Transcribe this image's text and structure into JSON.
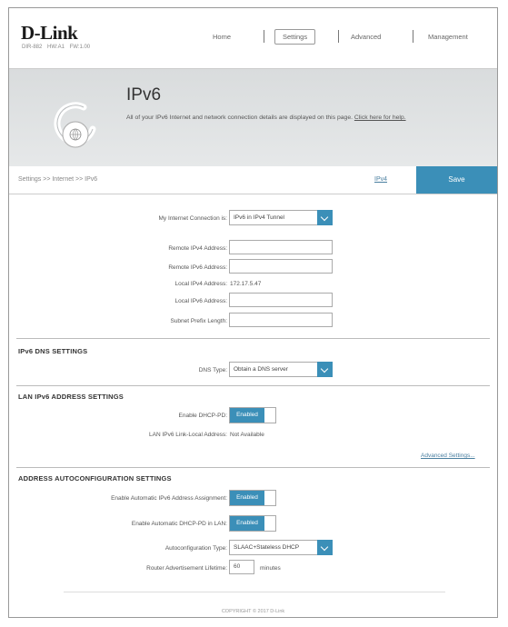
{
  "header": {
    "logo": "D-Link",
    "logo_sub": "DIR-882  HW:A1  FW:1.00",
    "nav": [
      "Home",
      "Settings",
      "Advanced",
      "Management"
    ],
    "active_nav": "Settings"
  },
  "banner": {
    "title": "IPv6",
    "description": "All of your IPv6 Internet and network connection details are displayed on this page.",
    "help_link": "Click here for help.",
    "icon": "ipv6-globe-icon"
  },
  "breadcrumb": "Settings >> Internet >> IPv6",
  "toolbar": {
    "ipv4_label": "IPv4",
    "save_label": "Save"
  },
  "connection": {
    "label": "My Internet Connection is:",
    "value": "IPv6 in IPv4 Tunnel",
    "fields": [
      {
        "label": "Remote IPv4 Address:",
        "value": ""
      },
      {
        "label": "Remote IPv6 Address:",
        "value": ""
      }
    ],
    "local_ipv4_label": "Local IPv4 Address:",
    "local_ipv4_value": "172.17.5.47",
    "fields2": [
      {
        "label": "Local IPv6 Address:",
        "value": ""
      },
      {
        "label": "Subnet Prefix Length:",
        "value": ""
      }
    ]
  },
  "dns": {
    "heading": "IPv6 DNS SETTINGS",
    "type_label": "DNS Type:",
    "type_value": "Obtain a DNS server"
  },
  "lan": {
    "heading": "LAN IPv6 ADDRESS SETTINGS",
    "dhcp_pd_label": "Enable DHCP-PD:",
    "dhcp_pd_value": "Enabled",
    "link_local_label": "LAN IPv6 Link-Local Address:",
    "link_local_value": "Not Available",
    "advanced_link": "Advanced Settings..."
  },
  "autoconfig": {
    "heading": "ADDRESS AUTOCONFIGURATION SETTINGS",
    "auto_assign_label": "Enable Automatic IPv6 Address Assignment:",
    "auto_assign_value": "Enabled",
    "auto_dhcp_pd_label": "Enable Automatic DHCP-PD in LAN:",
    "auto_dhcp_pd_value": "Enabled",
    "type_label": "Autoconfiguration Type:",
    "type_value": "SLAAC+Stateless DHCP",
    "lifetime_label": "Router Advertisement Lifetime:",
    "lifetime_value": "60",
    "lifetime_unit": "minutes"
  },
  "footer": {
    "copyright": "COPYRIGHT © 2017 D-Link"
  },
  "colors": {
    "accent": "#3b8fb8",
    "banner": "#dfe1e2"
  }
}
